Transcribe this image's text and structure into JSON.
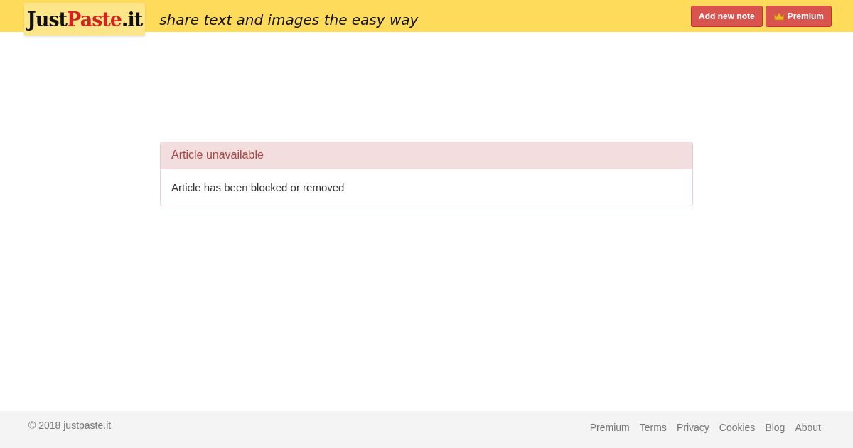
{
  "header": {
    "logo": [
      "Just",
      "Paste",
      ".it"
    ],
    "tagline": "share text and images the easy way",
    "buttons": [
      {
        "label": "Add new note",
        "kind": "plain"
      },
      {
        "label": "Premium",
        "kind": "crown"
      }
    ]
  },
  "alert": {
    "title": "Article unavailable",
    "message": "Article has been blocked or removed"
  },
  "footer": {
    "copyright": "© 2018 justpaste.it",
    "links": [
      "Premium",
      "Terms",
      "Privacy",
      "Cookies",
      "Blog",
      "About"
    ]
  }
}
